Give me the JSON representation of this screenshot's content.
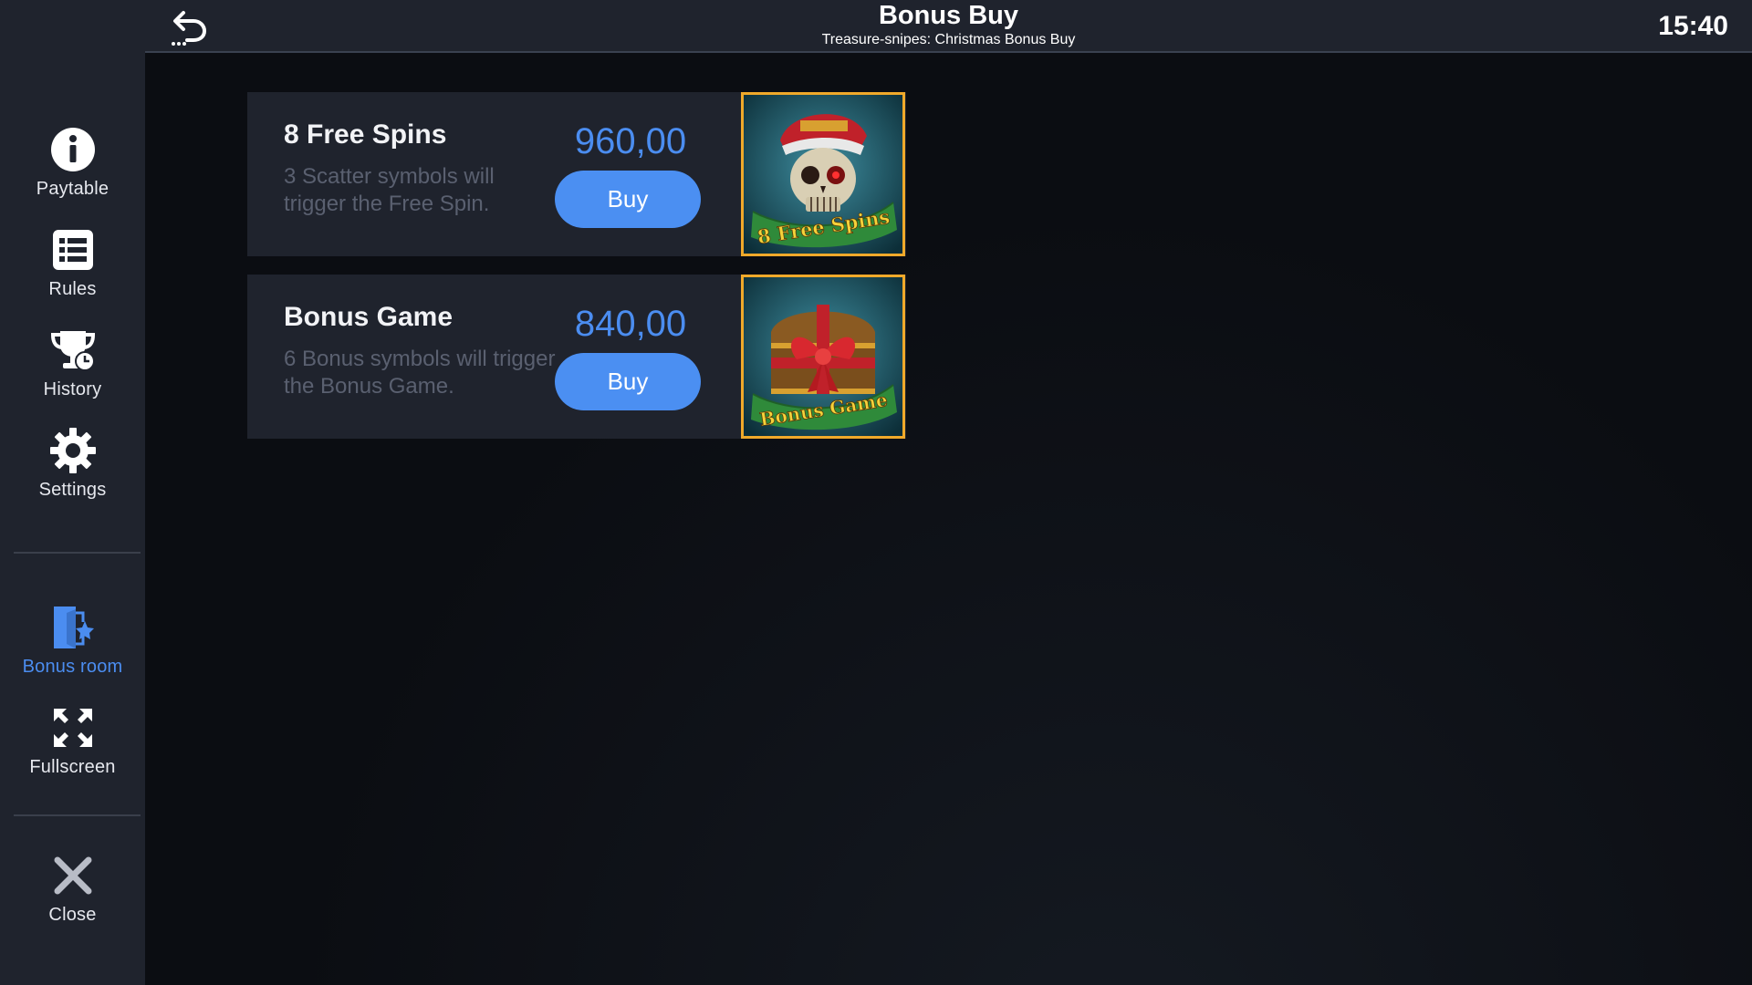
{
  "header": {
    "title": "Bonus Buy",
    "subtitle": "Treasure-snipes: Christmas Bonus Buy",
    "clock": "15:40"
  },
  "sidebar": {
    "items": [
      {
        "label": "Paytable",
        "icon": "info-icon"
      },
      {
        "label": "Rules",
        "icon": "list-icon"
      },
      {
        "label": "History",
        "icon": "trophy-clock-icon"
      },
      {
        "label": "Settings",
        "icon": "gear-icon"
      },
      {
        "label": "Bonus room",
        "icon": "door-star-icon",
        "active": true
      },
      {
        "label": "Fullscreen",
        "icon": "fullscreen-icon"
      },
      {
        "label": "Close",
        "icon": "close-icon"
      }
    ]
  },
  "offers": [
    {
      "name": "8 Free Spins",
      "description": "3 Scatter symbols will trigger the Free Spin.",
      "price": "960,00",
      "button_label": "Buy",
      "art_caption": "8 Free Spins"
    },
    {
      "name": "Bonus Game",
      "description": "6 Bonus symbols will trigger the Bonus Game.",
      "price": "840,00",
      "button_label": "Buy",
      "art_caption": "Bonus Game"
    }
  ],
  "colors": {
    "accent": "#4b8df0",
    "panel": "#1f232d",
    "background": "#0b0d12",
    "art_border": "#f0a92a"
  }
}
